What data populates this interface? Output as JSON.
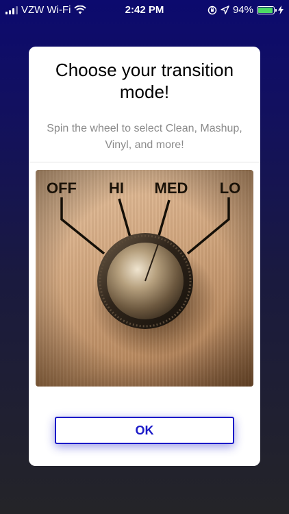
{
  "status_bar": {
    "carrier": "VZW Wi-Fi",
    "time": "2:42 PM",
    "battery": "94%",
    "icons": [
      "signal-bars-icon",
      "wifi-icon",
      "orientation-lock-icon",
      "location-arrow-icon",
      "battery-icon",
      "charging-bolt-icon"
    ]
  },
  "modal": {
    "title": "Choose your transition mode!",
    "subtitle": "Spin the wheel to select Clean, Mashup, Vinyl, and more!",
    "image_labels": [
      "OFF",
      "HI",
      "MED",
      "LO"
    ],
    "ok_label": "OK"
  },
  "colors": {
    "accent": "#1b1ac8",
    "background_top": "#0c0a6e",
    "background_bottom": "#242428",
    "battery_green": "#4cd964"
  }
}
